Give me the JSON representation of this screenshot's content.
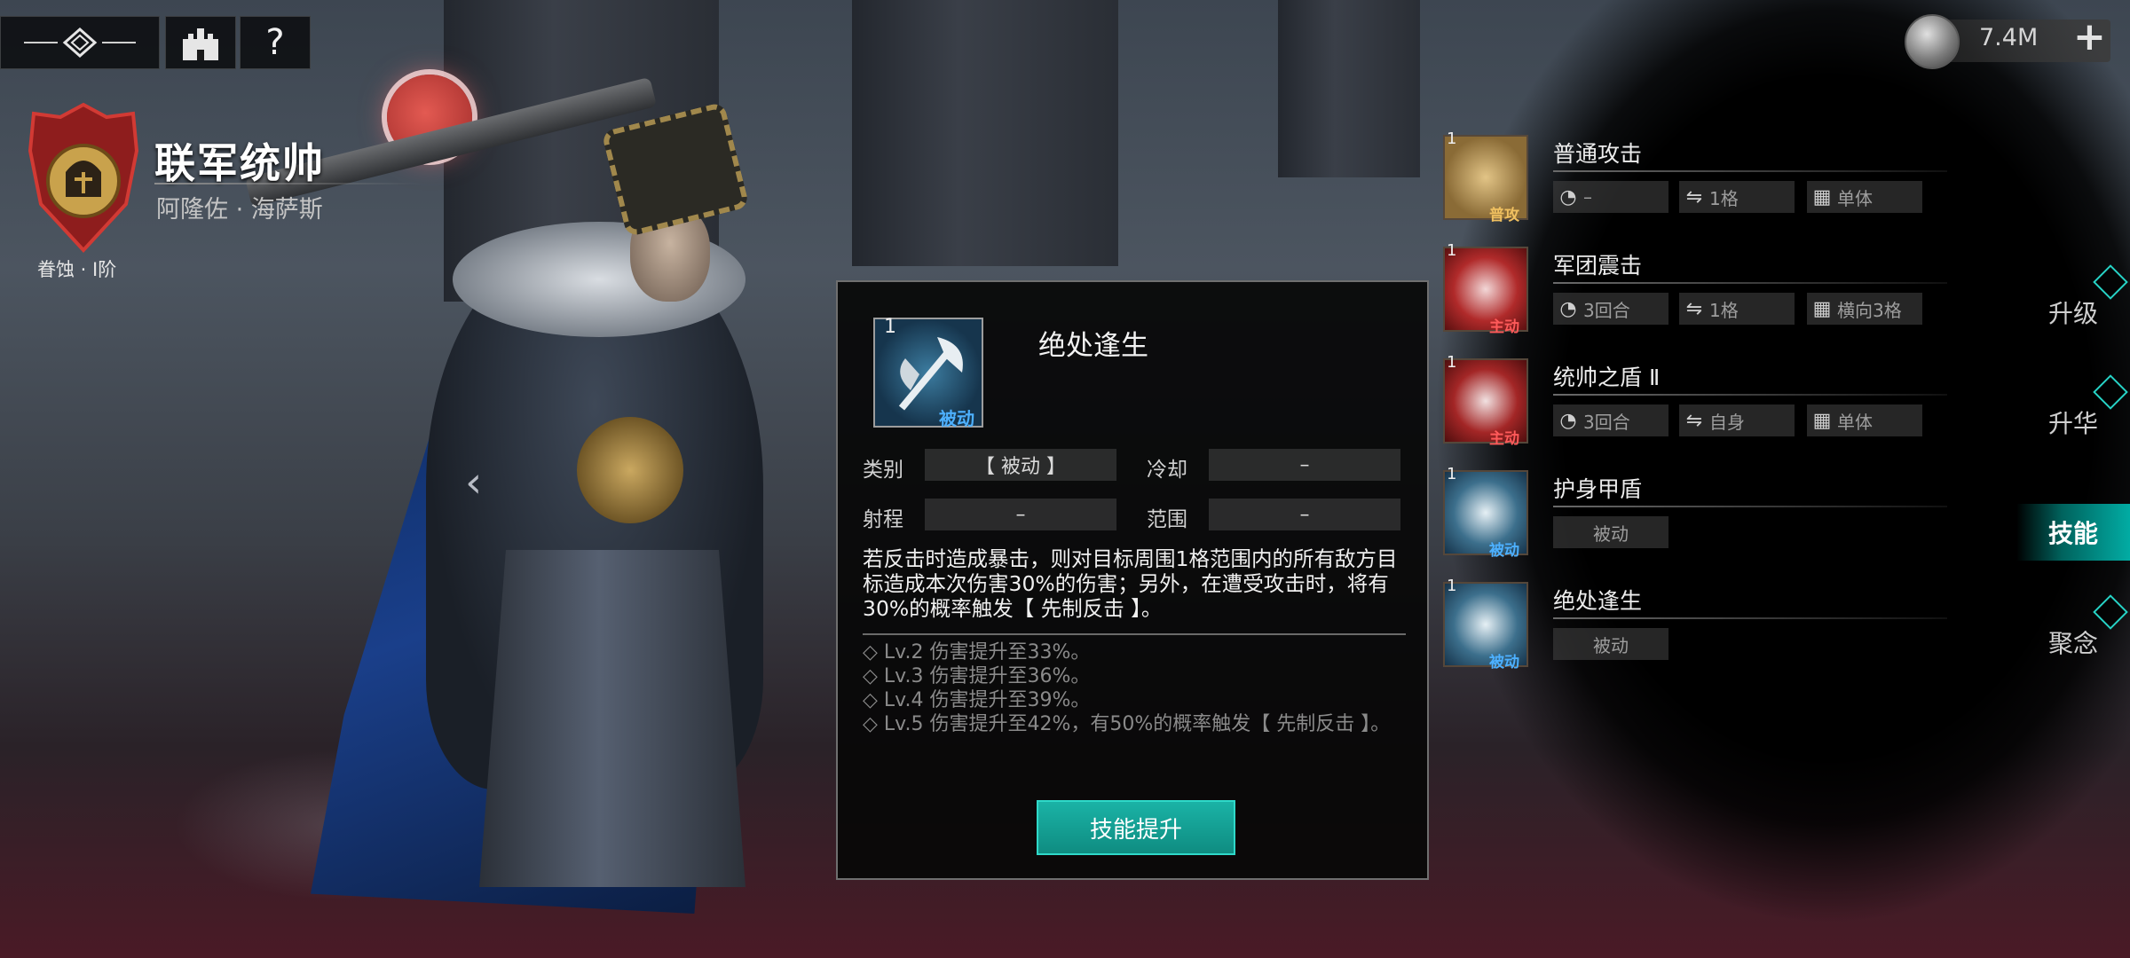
{
  "hero": {
    "title": "联军统帅",
    "name": "阿隆佐 · 海萨斯",
    "rank": "眷蚀 · Ⅰ阶"
  },
  "nav": {
    "help_label": "?"
  },
  "currency": {
    "value": "7.4M",
    "plus": "+"
  },
  "skills": [
    {
      "level": "1",
      "name": "普通攻击",
      "tag": "普攻",
      "tag_color": "#f0c060",
      "icon": "slash-attack-icon",
      "cooldown": "–",
      "range": "1格",
      "target": "单体"
    },
    {
      "level": "1",
      "name": "军团震击",
      "tag": "主动",
      "tag_color": "#ff5a5a",
      "icon": "shockwave-icon",
      "cooldown": "3回合",
      "range": "1格",
      "target": "横向3格"
    },
    {
      "level": "1",
      "name": "统帅之盾 Ⅱ",
      "tag": "主动",
      "tag_color": "#ff5a5a",
      "icon": "sword-shield-icon",
      "cooldown": "3回合",
      "range": "自身",
      "target": "单体"
    },
    {
      "level": "1",
      "name": "护身甲盾",
      "tag": "被动",
      "tag_color": "#4db0ff",
      "icon": "spiked-shield-icon",
      "passive_label": "被动"
    },
    {
      "level": "1",
      "name": "绝处逢生",
      "tag": "被动",
      "tag_color": "#4db0ff",
      "icon": "axe-icon",
      "passive_label": "被动"
    }
  ],
  "side_tabs": [
    {
      "label": "升级"
    },
    {
      "label": "升华"
    },
    {
      "label": "技能",
      "active": true
    },
    {
      "label": "聚念"
    }
  ],
  "popup": {
    "level": "1",
    "tag": "被动",
    "title": "绝处逢生",
    "category_label": "类别",
    "category_value": "【 被动 】",
    "cooldown_label": "冷却",
    "cooldown_value": "–",
    "range_label": "射程",
    "range_value": "–",
    "area_label": "范围",
    "area_value": "–",
    "description": "若反击时造成暴击，则对目标周围1格范围内的所有敌方目标造成本次伤害30%的伤害；另外，在遭受攻击时，将有30%的概率触发【 先制反击 】。",
    "upgrades": [
      "◇ Lv.2 伤害提升至33%。",
      "◇ Lv.3 伤害提升至36%。",
      "◇ Lv.4 伤害提升至39%。",
      "◇ Lv.5 伤害提升至42%，有50%的概率触发【 先制反击 】。"
    ],
    "upgrade_button": "技能提升"
  },
  "colors": {
    "accent": "#1ab3a6",
    "passive_tag": "#4db0ff",
    "active_tag": "#ff5a5a",
    "normal_tag": "#f0c060"
  }
}
